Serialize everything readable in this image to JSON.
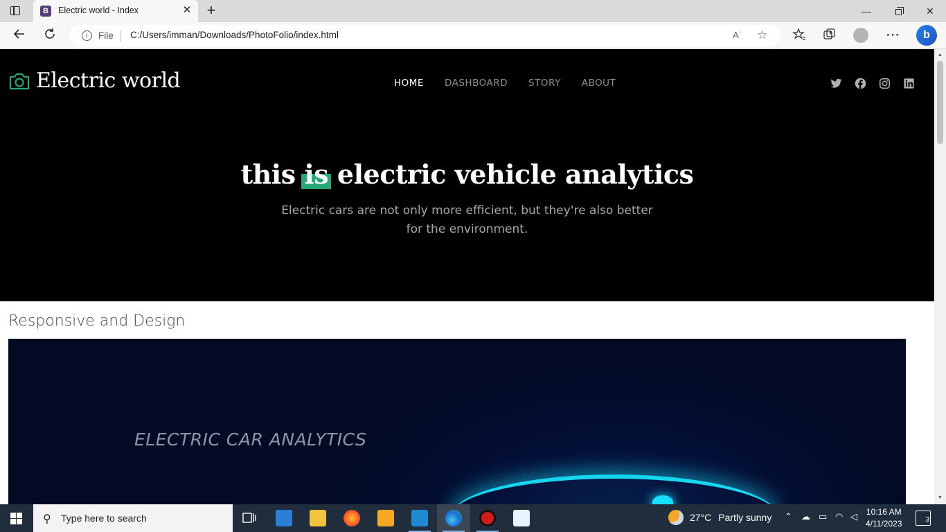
{
  "browser": {
    "tab_title": "Electric world - Index",
    "tab_favicon": "B",
    "url_scheme_label": "File",
    "url": "C:/Users/imman/Downloads/PhotoFolio/index.html",
    "read_aloud_label": "Aʾ"
  },
  "site": {
    "brand": "Electric world",
    "nav": [
      {
        "label": "HOME",
        "active": true
      },
      {
        "label": "DASHBOARD",
        "active": false
      },
      {
        "label": "STORY",
        "active": false
      },
      {
        "label": "ABOUT",
        "active": false
      }
    ],
    "social_icons": [
      "twitter-icon",
      "facebook-icon",
      "instagram-icon",
      "linkedin-icon"
    ],
    "accent_color": "#27a776"
  },
  "hero": {
    "title_before": "this ",
    "title_highlight": "is",
    "title_after": " electric vehicle analytics",
    "subtitle": "Electric cars are not only more efficient, but they're also better for the environment."
  },
  "section": {
    "title": "Responsive and Design",
    "showcase_label": "ELECTRIC CAR ANALYTICS"
  },
  "taskbar": {
    "search_placeholder": "Type here to search",
    "weather_temp": "27°C",
    "weather_text": "Partly sunny",
    "time": "10:16 AM",
    "date": "4/11/2023",
    "notification_count": "3"
  }
}
